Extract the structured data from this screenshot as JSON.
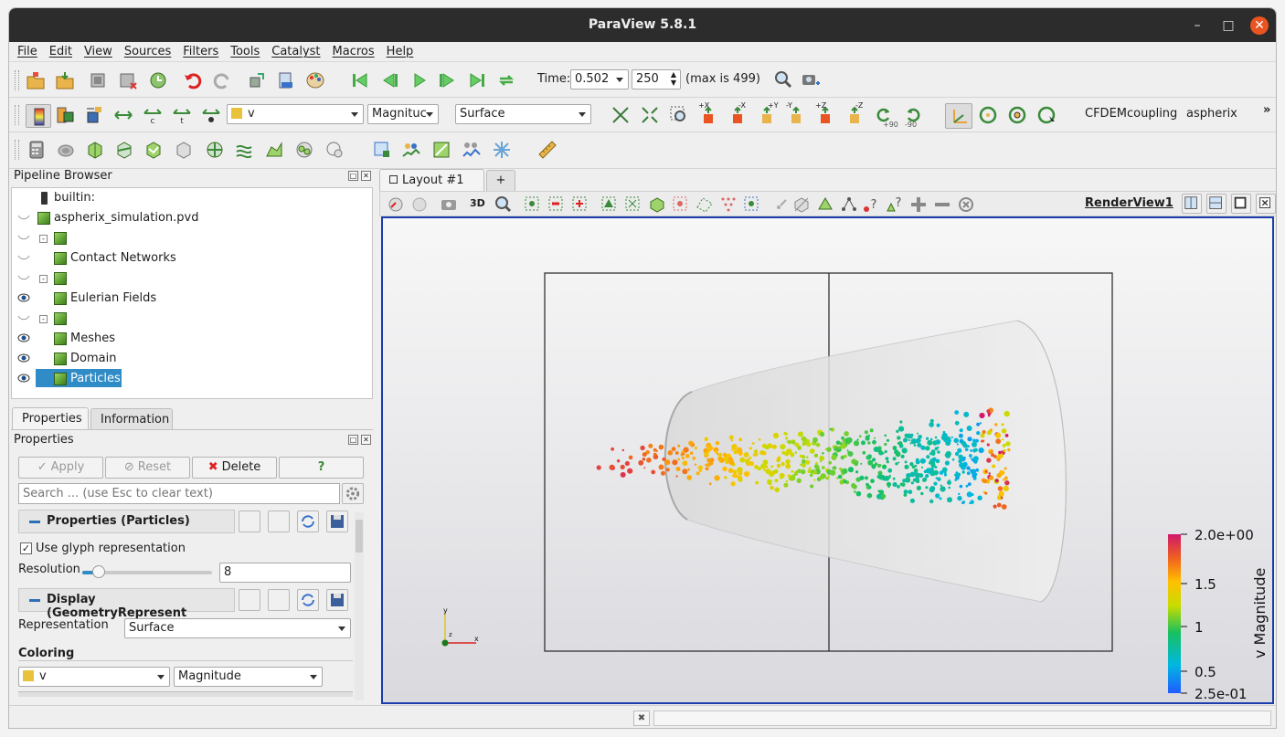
{
  "window": {
    "title": "ParaView 5.8.1"
  },
  "menu": [
    "File",
    "Edit",
    "View",
    "Sources",
    "Filters",
    "Tools",
    "Catalyst",
    "Macros",
    "Help"
  ],
  "time_toolbar": {
    "time_label": "Time:",
    "time_value": "0.502",
    "step_value": "250",
    "max_text": "(max is 499)"
  },
  "color_toolbar": {
    "array": "v",
    "component": "Magnitude",
    "component_shown": "Magnituc",
    "representation": "Surface"
  },
  "custom_toolbar": {
    "item1": "CFDEMcoupling",
    "item2": "aspherix",
    "more": "»"
  },
  "camera_labels": {
    "px": "+X",
    "mx": "-X",
    "py": "+Y",
    "my": "-Y",
    "pz": "+Z",
    "mz": "-Z",
    "rot_p90": "+90",
    "rot_m90": "-90"
  },
  "pipeline": {
    "title": "Pipeline Browser",
    "items": [
      {
        "label": "builtin:"
      },
      {
        "label": "aspherix_simulation.pvd"
      },
      {
        "label": ""
      },
      {
        "label": "Contact Networks"
      },
      {
        "label": ""
      },
      {
        "label": "Eulerian Fields"
      },
      {
        "label": ""
      },
      {
        "label": "Meshes"
      },
      {
        "label": "Domain"
      },
      {
        "label": "Particles"
      }
    ]
  },
  "props_tabs": {
    "properties": "Properties",
    "information": "Information"
  },
  "properties": {
    "title": "Properties",
    "apply": "Apply",
    "reset": "Reset",
    "delete": "Delete",
    "help": "?",
    "search_placeholder": "Search ... (use Esc to clear text)",
    "section1": "Properties (Particles)",
    "glyph_checkbox": "Use glyph representation",
    "resolution_label": "Resolution",
    "resolution_value": "8",
    "resolution_fraction": 0.09,
    "section2": "Display (GeometryRepresent",
    "representation_label": "Representation",
    "representation_value": "Surface",
    "coloring_label": "Coloring",
    "coloring_array": "v",
    "coloring_component": "Magnitude"
  },
  "layout": {
    "tab_label": "Layout #1",
    "add_tab": "+",
    "view_name": "RenderView1",
    "btn_3d": "3D"
  },
  "scalar_bar": {
    "title": "v Magnitude",
    "max": "2.0e+00",
    "t15": "1.5",
    "t1": "1",
    "t05": "0.5",
    "min": "2.5e-01"
  },
  "axes": {
    "y": "y",
    "z": "z",
    "x": "x"
  },
  "colors": {
    "accent": "#1a3cad",
    "selection": "#308cc6",
    "titlebar": "#2c2c2c",
    "close": "#e95420"
  }
}
